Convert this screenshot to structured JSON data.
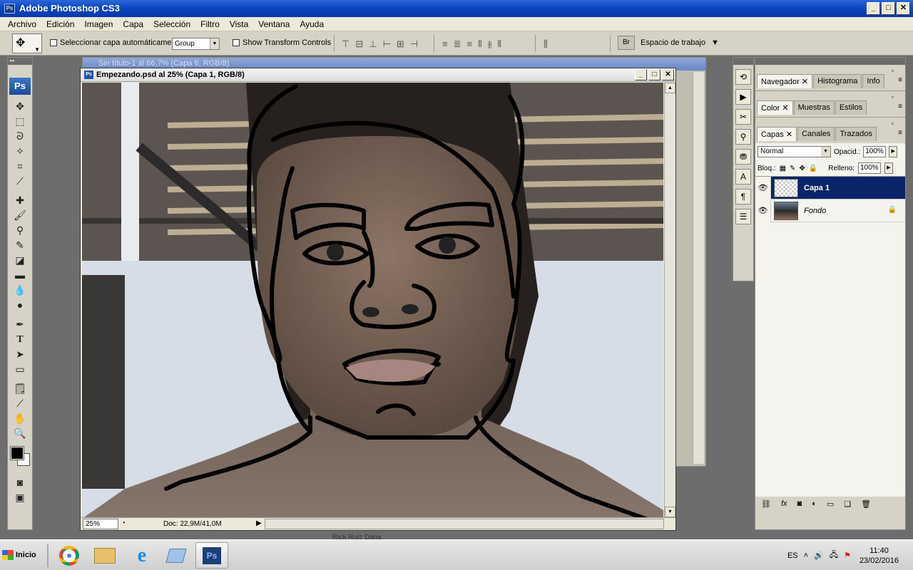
{
  "app": {
    "title": "Adobe Photoshop CS3",
    "icon": "Ps"
  },
  "menu": [
    "Archivo",
    "Edición",
    "Imagen",
    "Capa",
    "Selección",
    "Filtro",
    "Vista",
    "Ventana",
    "Ayuda"
  ],
  "options": {
    "auto_select_label": "Seleccionar capa automáticamente",
    "auto_select_value": "Group",
    "transform_label": "Show Transform Controls",
    "workspace_label": "Espacio de trabajo"
  },
  "back_document": {
    "title": "Sin título-1 al 66,7% (Capa 6, RGB/8)"
  },
  "document": {
    "title": "Empezando.psd al 25% (Capa 1, RGB/8)",
    "zoom": "25%",
    "doc_info": "Doc: 22,9M/41,0M"
  },
  "panels": {
    "group1_tabs": [
      "Navegador",
      "Histograma",
      "Info"
    ],
    "group2_tabs": [
      "Color",
      "Muestras",
      "Estilos"
    ],
    "group3_tabs": [
      "Capas",
      "Canales",
      "Trazados"
    ],
    "blend_mode": "Normal",
    "opacity_label": "Opacid.:",
    "opacity_value": "100%",
    "lock_label": "Bloq.:",
    "fill_label": "Relleno:",
    "fill_value": "100%",
    "layers": [
      {
        "name": "Capa 1",
        "selected": true
      },
      {
        "name": "Fondo",
        "selected": false,
        "locked": true
      }
    ]
  },
  "taskbar": {
    "start_label": "Inicio",
    "language": "ES",
    "time": "11:40",
    "date": "23/02/2016",
    "bottom_text": "Rick Ruiz Dana"
  },
  "colors": {
    "titlebar": "#0a45c0",
    "selected_layer": "#0a246a",
    "foreground": "#000000",
    "background": "#ffffff"
  }
}
